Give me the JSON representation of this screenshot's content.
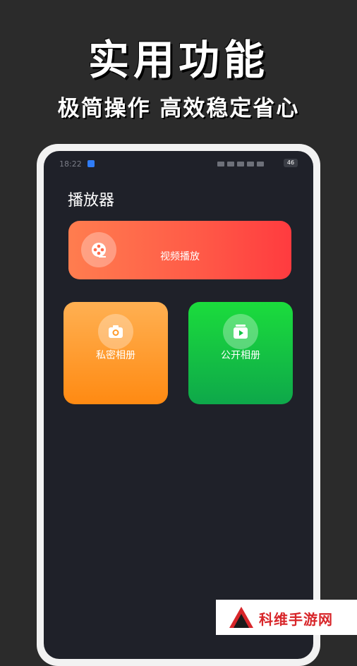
{
  "promo": {
    "title": "实用功能",
    "subtitle": "极简操作 高效稳定省心"
  },
  "status_bar": {
    "time": "18:22",
    "battery": "46"
  },
  "page": {
    "title": "播放器"
  },
  "cards": {
    "video": {
      "label": "视频播放",
      "icon": "film-reel-icon"
    },
    "private_album": {
      "label": "私密相册",
      "icon": "camera-icon"
    },
    "public_album": {
      "label": "公开相册",
      "icon": "play-album-icon"
    }
  },
  "watermark": {
    "text": "科维手游网"
  },
  "colors": {
    "background": "#2b2b2b",
    "screen": "#1f2129",
    "video_card": "#ff5947",
    "private_card": "#ff9a2a",
    "public_card": "#13c544",
    "watermark_text": "#d8262a"
  }
}
